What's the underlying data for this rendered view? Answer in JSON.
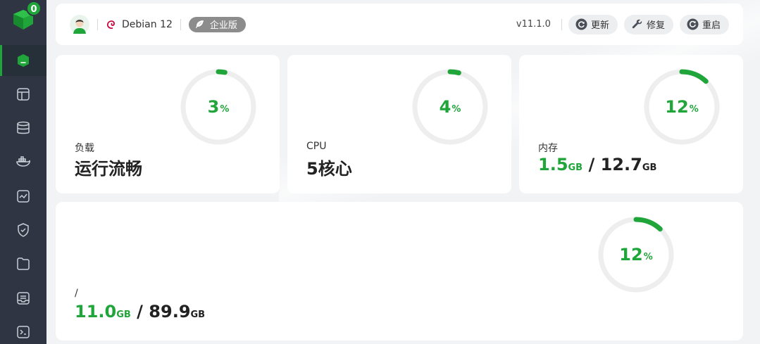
{
  "sidebar": {
    "logo_icon": "bt-panel-logo-icon",
    "message_count": "0",
    "items": [
      {
        "name": "home",
        "icon": "home-icon",
        "active": true
      },
      {
        "name": "website",
        "icon": "website-icon"
      },
      {
        "name": "database",
        "icon": "database-icon"
      },
      {
        "name": "docker",
        "icon": "docker-icon"
      },
      {
        "name": "monitor",
        "icon": "monitor-icon"
      },
      {
        "name": "security",
        "icon": "shield-icon"
      },
      {
        "name": "files",
        "icon": "folder-icon"
      },
      {
        "name": "logs",
        "icon": "log-icon"
      },
      {
        "name": "terminal",
        "icon": "terminal-icon"
      }
    ]
  },
  "header": {
    "os_name": "Debian 12",
    "edition": "企业版",
    "version": "v11.1.0",
    "buttons": {
      "update": "更新",
      "repair": "修复",
      "restart": "重启"
    }
  },
  "cards": {
    "load": {
      "label": "负载",
      "value": "运行流畅",
      "percent": 3,
      "percent_text": "3",
      "pct_sign": "%"
    },
    "cpu": {
      "label": "CPU",
      "value": "5核心",
      "percent": 4,
      "percent_text": "4",
      "pct_sign": "%"
    },
    "memory": {
      "label": "内存",
      "used": "1.5",
      "used_unit": "GB",
      "slash": " / ",
      "total": "12.7",
      "total_unit": "GB",
      "percent": 12,
      "percent_text": "12",
      "pct_sign": "%"
    },
    "disk": {
      "label": "/",
      "used": "11.0",
      "used_unit": "GB",
      "slash": " / ",
      "total": "89.9",
      "total_unit": "GB",
      "percent": 12,
      "percent_text": "12",
      "pct_sign": "%"
    }
  },
  "colors": {
    "accent": "#20a53a",
    "track": "#eeeeee",
    "sidebar_bg": "#2f3542"
  }
}
